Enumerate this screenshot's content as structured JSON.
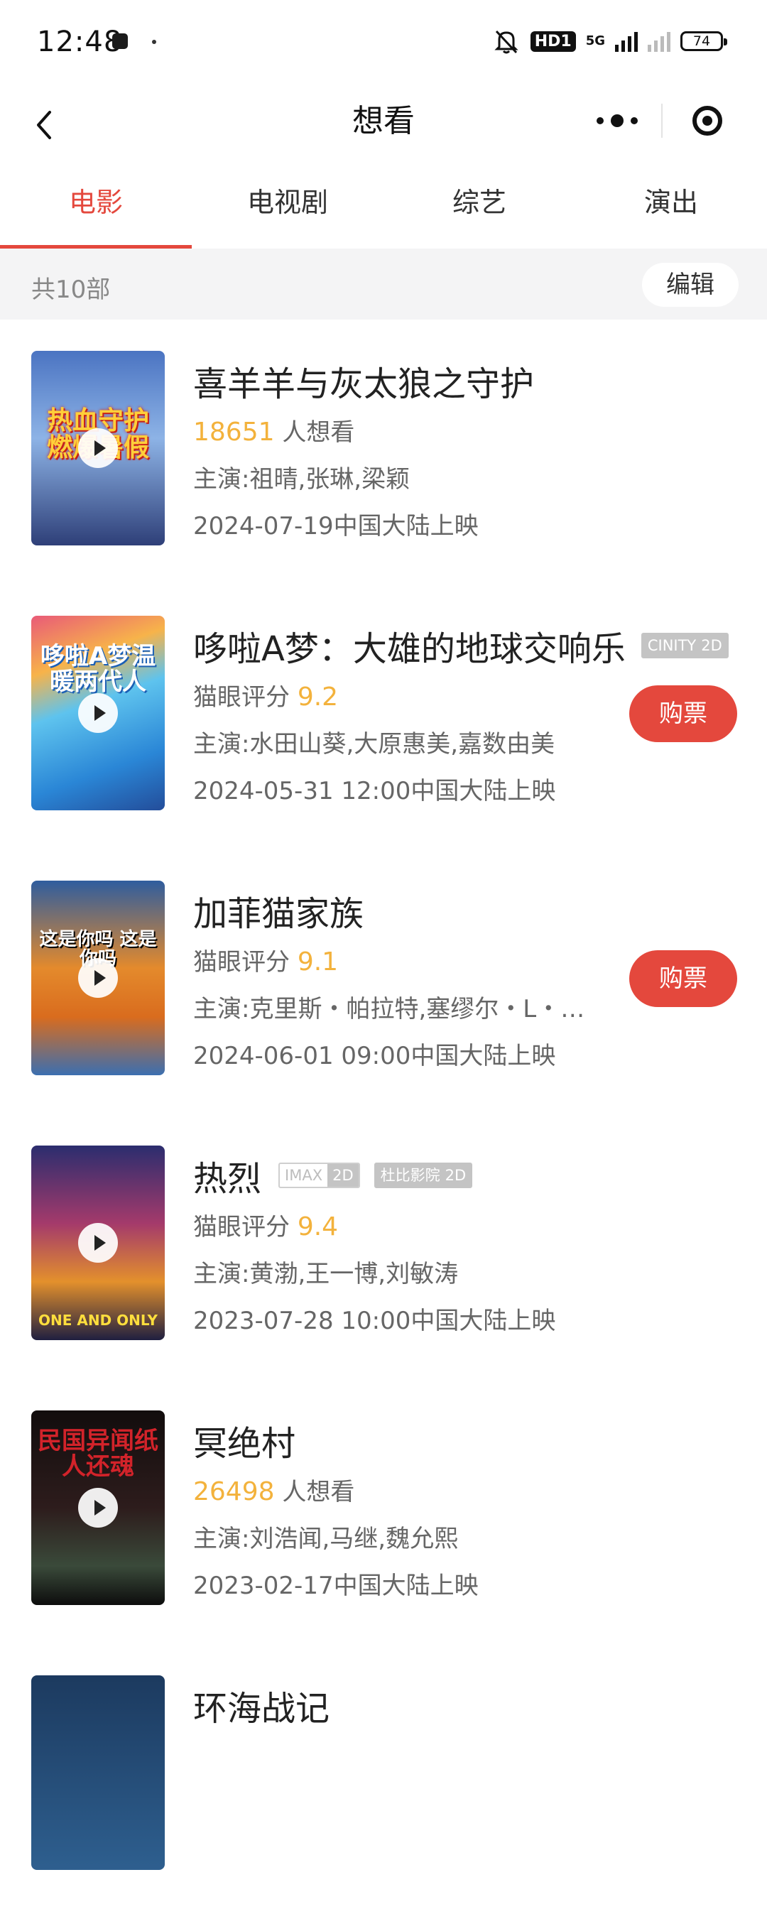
{
  "status_bar": {
    "time": "12:48",
    "network_badge": "HD1",
    "network_type": "5G",
    "battery": "74"
  },
  "nav": {
    "title": "想看"
  },
  "tabs": [
    {
      "label": "电影",
      "active": true
    },
    {
      "label": "电视剧",
      "active": false
    },
    {
      "label": "综艺",
      "active": false
    },
    {
      "label": "演出",
      "active": false
    }
  ],
  "summary": {
    "count_text": "共10部",
    "edit_label": "编辑"
  },
  "movies": [
    {
      "title": "喜羊羊与灰太狼之守护",
      "metric_value": "18651",
      "metric_label": " 人想看",
      "cast": "主演:祖晴,张琳,梁颖",
      "release": "2024-07-19中国大陆上映",
      "poster_text": "热血守护燃爆暑假",
      "tags": [],
      "buy_label": ""
    },
    {
      "title": "哆啦A梦：大雄的地球交响乐",
      "metric_label": "猫眼评分 ",
      "metric_value": "9.2",
      "cast": "主演:水田山葵,大原惠美,嘉数由美",
      "release": "2024-05-31 12:00中国大陆上映",
      "poster_text": "哆啦A梦温暖两代人",
      "tags": [
        {
          "left": "CINITY",
          "right": "2D"
        }
      ],
      "buy_label": "购票"
    },
    {
      "title": "加菲猫家族",
      "metric_label": "猫眼评分 ",
      "metric_value": "9.1",
      "cast": "主演:克里斯・帕拉特,塞缪尔・L・…",
      "release": "2024-06-01 09:00中国大陆上映",
      "poster_text": "这是你吗 这是你吗",
      "tags": [],
      "buy_label": "购票"
    },
    {
      "title": "热烈",
      "metric_label": "猫眼评分 ",
      "metric_value": "9.4",
      "cast": "主演:黄渤,王一博,刘敏涛",
      "release": "2023-07-28 10:00中国大陆上映",
      "poster_text": "ONE AND ONLY",
      "tags": [
        {
          "left": "IMAX",
          "right": "2D"
        },
        {
          "left": "杜比影院",
          "right": "2D"
        }
      ],
      "buy_label": ""
    },
    {
      "title": "冥绝村",
      "metric_value": "26498",
      "metric_label": " 人想看",
      "cast": "主演:刘浩闻,马继,魏允熙",
      "release": "2023-02-17中国大陆上映",
      "poster_text": "民国异闻纸人还魂",
      "tags": [],
      "buy_label": ""
    },
    {
      "title": "环海战记",
      "poster_text": ""
    }
  ],
  "colors": {
    "accent": "#e4483d",
    "highlight": "#f3b23c"
  }
}
